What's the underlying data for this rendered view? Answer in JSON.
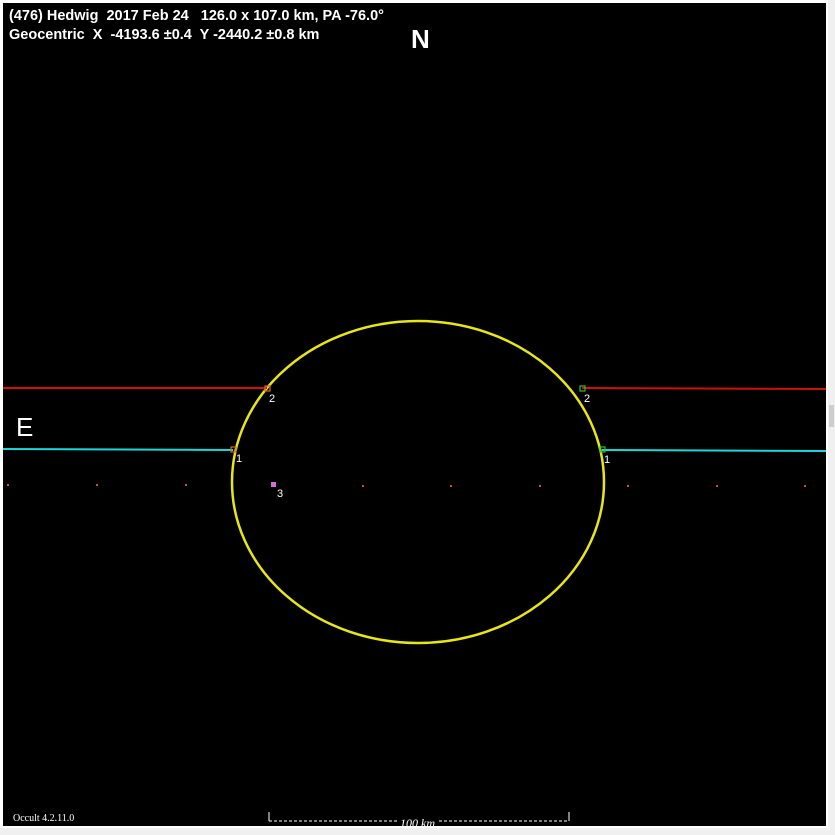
{
  "header": {
    "line1": "(476) Hedwig  2017 Feb 24   126.0 x 107.0 km, PA -76.0°",
    "line2": "Geocentric  X  -4193.6 ±0.4  Y -2440.2 ±0.8 km"
  },
  "labels": {
    "north": "N",
    "east": "E",
    "version": "Occult 4.2.11.0",
    "scale": "100 km"
  },
  "colors": {
    "background": "#000000",
    "ellipse": "#e6e619",
    "chord_red": "#d01010",
    "chord_cyan": "#19d9d9",
    "miss_dots": "#c05060",
    "marker_orange": "#d86a1e",
    "marker_green": "#2ec02e",
    "marker_magenta": "#d070d0"
  },
  "chords": [
    {
      "id": "red",
      "color": "red",
      "disappear_label": "2",
      "reappear_label": "2"
    },
    {
      "id": "cyan",
      "color": "cyan",
      "disappear_label": "1",
      "reappear_label": "1"
    }
  ],
  "single_point": {
    "label": "3"
  },
  "ellipse": {
    "major_km": 126.0,
    "minor_km": 107.0,
    "pa_deg": -76.0
  }
}
